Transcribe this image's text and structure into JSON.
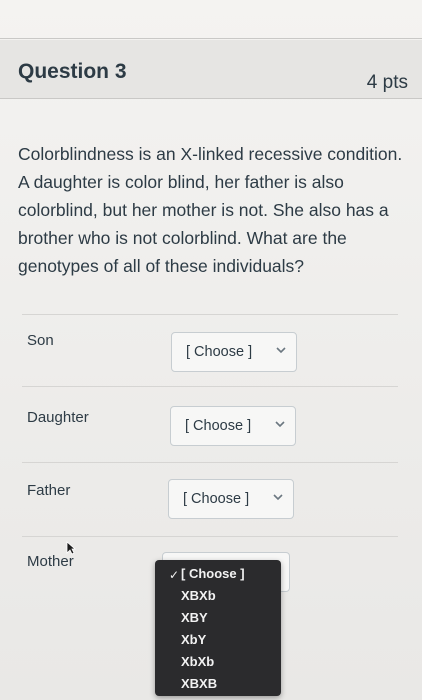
{
  "question": {
    "title": "Question 3",
    "points": "4 pts",
    "text": "Colorblindness is an X-linked recessive condition. A daughter is color blind, her father is also colorblind, but her mother is not. She also has a brother who is not colorblind. What are the genotypes of all of these individuals?"
  },
  "answers": [
    {
      "label": "Son",
      "selected": "[ Choose ]"
    },
    {
      "label": "Daughter",
      "selected": "[ Choose ]"
    },
    {
      "label": "Father",
      "selected": "[ Choose ]"
    },
    {
      "label": "Mother",
      "selected": "[ Choose ]"
    }
  ],
  "dropdown": {
    "options": [
      "[ Choose ]",
      "XBXb",
      "XBY",
      "XbY",
      "XbXb",
      "XBXB"
    ]
  },
  "icons": {
    "select_chevron": "chevron-down-icon",
    "selected_check": "checkmark-icon",
    "cursor": "mouse-pointer-icon"
  }
}
